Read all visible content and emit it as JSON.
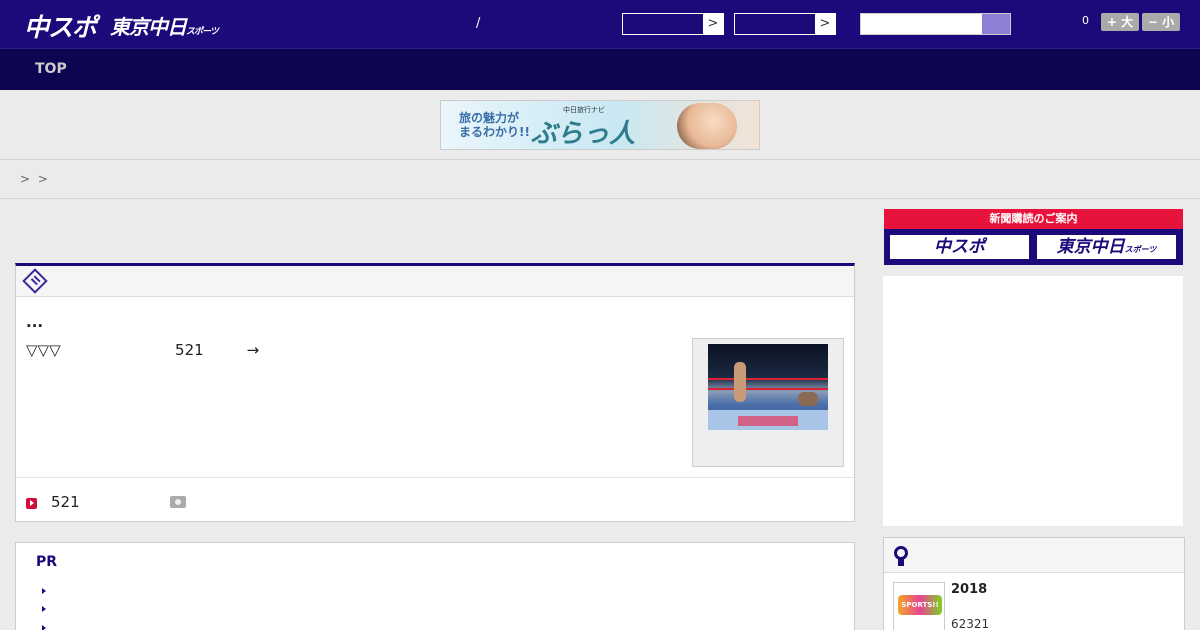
{
  "header": {
    "logo_main": "中スポ",
    "logo_sub": "東京中日",
    "logo_sub_small": "スポーツ",
    "separator": "/",
    "select_arrow": ">",
    "font_count": "0",
    "font_large_label": "+ 大",
    "font_small_label": "− 小"
  },
  "nav": {
    "top_label": "TOP"
  },
  "banner": {
    "line1": "旅の魅力が",
    "line2": "まるわかり!!",
    "brand_small": "中日旅行ナビ",
    "brand": "ぶらっ人"
  },
  "breadcrumb": {
    "text": "> >"
  },
  "article": {
    "title": "...",
    "desc_symbols": "▽▽▽",
    "desc_count": "521",
    "desc_arrow": "→",
    "foot_count": "521"
  },
  "pr": {
    "title": "PR"
  },
  "sidebar": {
    "subscribe_head": "新聞購読のご案内",
    "subscribe_btn1": "中スポ",
    "subscribe_btn2": "東京中日",
    "subscribe_btn2_small": "スポーツ"
  },
  "ranking": {
    "thumb_text": "SPORTS!!",
    "year": "2018",
    "number": "62321"
  },
  "colors": {
    "header_bg": "#1a0a7a",
    "nav_bg": "#0d0552",
    "accent_red": "#e8133c"
  }
}
